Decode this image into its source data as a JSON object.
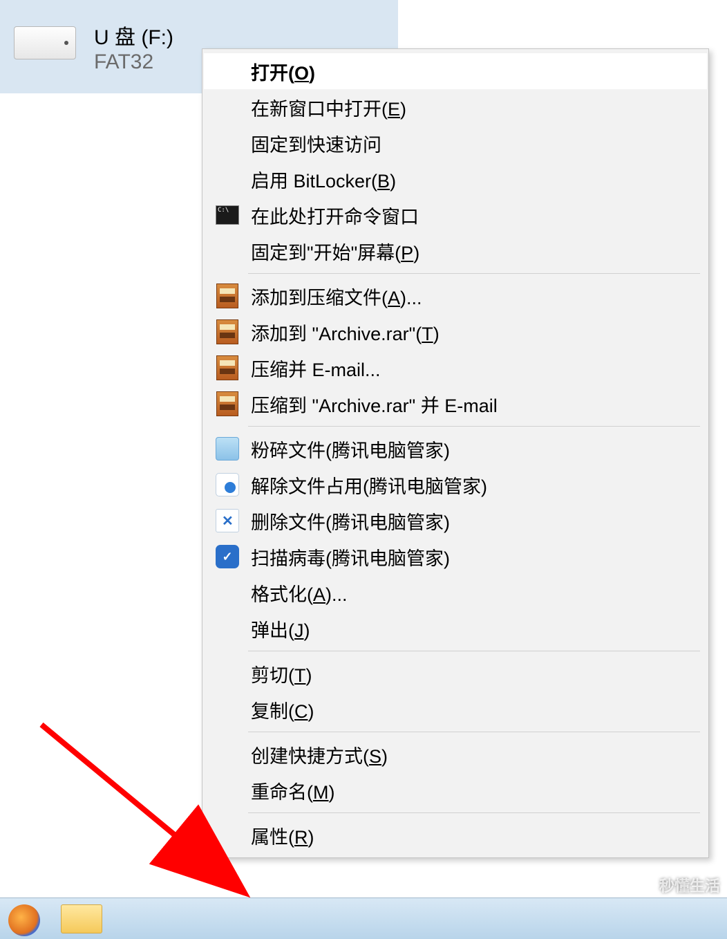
{
  "drive": {
    "name": "U 盘 (F:)",
    "filesystem": "FAT32"
  },
  "menu": {
    "items": [
      {
        "label_pre": "打开(",
        "accel": "O",
        "label_post": ")",
        "icon": "none",
        "default": true,
        "highlight": true
      },
      {
        "label_pre": "在新窗口中打开(",
        "accel": "E",
        "label_post": ")",
        "icon": "none"
      },
      {
        "label_pre": "固定到快速访问",
        "accel": "",
        "label_post": "",
        "icon": "none"
      },
      {
        "label_pre": "启用 BitLocker(",
        "accel": "B",
        "label_post": ")",
        "icon": "none"
      },
      {
        "label_pre": "在此处打开命令窗口",
        "accel": "",
        "label_post": "",
        "icon": "cmd"
      },
      {
        "label_pre": "固定到\"开始\"屏幕(",
        "accel": "P",
        "label_post": ")",
        "icon": "none"
      },
      {
        "sep": true
      },
      {
        "label_pre": "添加到压缩文件(",
        "accel": "A",
        "label_post": ")...",
        "icon": "rar"
      },
      {
        "label_pre": "添加到 \"Archive.rar\"(",
        "accel": "T",
        "label_post": ")",
        "icon": "rar"
      },
      {
        "label_pre": "压缩并 E-mail...",
        "accel": "",
        "label_post": "",
        "icon": "rar"
      },
      {
        "label_pre": "压缩到 \"Archive.rar\" 并 E-mail",
        "accel": "",
        "label_post": "",
        "icon": "rar"
      },
      {
        "sep": true
      },
      {
        "label_pre": "粉碎文件(腾讯电脑管家)",
        "accel": "",
        "label_post": "",
        "icon": "shred"
      },
      {
        "label_pre": "解除文件占用(腾讯电脑管家)",
        "accel": "",
        "label_post": "",
        "icon": "unlock"
      },
      {
        "label_pre": "删除文件(腾讯电脑管家)",
        "accel": "",
        "label_post": "",
        "icon": "delete"
      },
      {
        "label_pre": "扫描病毒(腾讯电脑管家)",
        "accel": "",
        "label_post": "",
        "icon": "scan"
      },
      {
        "label_pre": "格式化(",
        "accel": "A",
        "label_post": ")...",
        "icon": "none"
      },
      {
        "label_pre": "弹出(",
        "accel": "J",
        "label_post": ")",
        "icon": "none"
      },
      {
        "sep": true
      },
      {
        "label_pre": "剪切(",
        "accel": "T",
        "label_post": ")",
        "icon": "none"
      },
      {
        "label_pre": "复制(",
        "accel": "C",
        "label_post": ")",
        "icon": "none"
      },
      {
        "sep": true
      },
      {
        "label_pre": "创建快捷方式(",
        "accel": "S",
        "label_post": ")",
        "icon": "none"
      },
      {
        "label_pre": "重命名(",
        "accel": "M",
        "label_post": ")",
        "icon": "none"
      },
      {
        "sep": true
      },
      {
        "label_pre": "属性(",
        "accel": "R",
        "label_post": ")",
        "icon": "none"
      }
    ]
  },
  "annotation": {
    "arrow_color": "#ff0000"
  },
  "watermark": {
    "text": "秒懂生活"
  }
}
